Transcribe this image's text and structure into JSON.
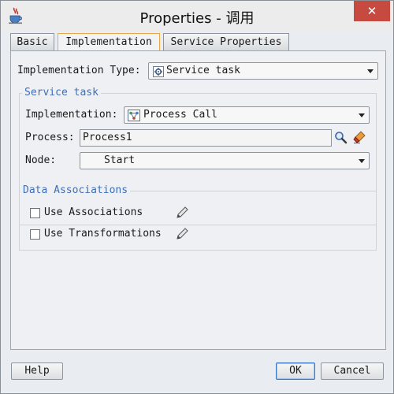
{
  "window": {
    "title": "Properties - 调用",
    "close_label": "✕"
  },
  "tabs": [
    {
      "label": "Basic"
    },
    {
      "label": "Implementation"
    },
    {
      "label": "Service Properties"
    }
  ],
  "form": {
    "implementation_type_label": "Implementation Type:",
    "implementation_type_value": "Service task",
    "service_task_group": {
      "title": "Service task",
      "implementation_label": "Implementation:",
      "implementation_value": "Process Call",
      "process_label": "Process:",
      "process_value": "Process1",
      "node_label": "Node:",
      "node_value": "Start"
    },
    "data_associations_group": {
      "title": "Data Associations",
      "use_associations_label": "Use Associations",
      "use_associations_checked": false,
      "use_transformations_label": "Use Transformations",
      "use_transformations_checked": false
    }
  },
  "buttons": {
    "help": "Help",
    "ok": "OK",
    "cancel": "Cancel"
  },
  "icons": {
    "app": "coffee-cup-icon",
    "service_task": "gear-icon",
    "process_call": "process-call-icon",
    "search": "magnifier-icon",
    "clear": "eraser-icon",
    "edit": "pencil-icon"
  },
  "colors": {
    "close_button": "#c74a41",
    "group_title": "#3f6fb5",
    "active_tab_border": "#e8a845",
    "default_button_border": "#3b78c4"
  }
}
